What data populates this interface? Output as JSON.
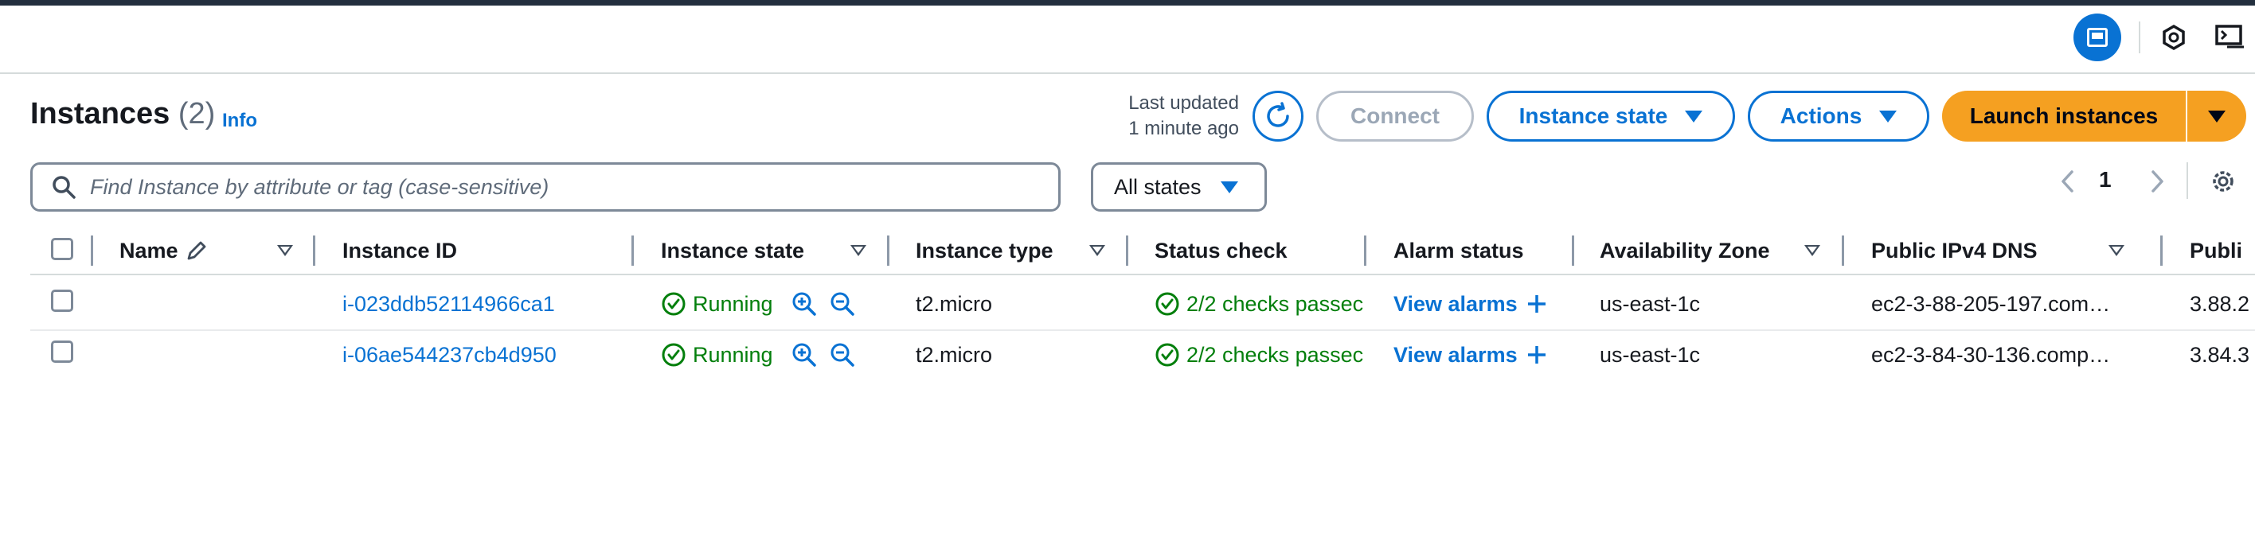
{
  "colors": {
    "accent": "#0972d3",
    "success": "#037f0c",
    "primary_button": "#f5a021",
    "border": "#7d8998"
  },
  "header": {
    "title": "Instances",
    "count": "(2)",
    "info_link": "Info",
    "last_updated_line1": "Last updated",
    "last_updated_line2": "1 minute ago",
    "connect_label": "Connect",
    "instance_state_label": "Instance state",
    "actions_label": "Actions",
    "launch_label": "Launch instances"
  },
  "search": {
    "placeholder": "Find Instance by attribute or tag (case-sensitive)"
  },
  "filter": {
    "states_label": "All states"
  },
  "pagination": {
    "current_page": "1"
  },
  "table": {
    "columns": [
      "Name",
      "Instance ID",
      "Instance state",
      "Instance type",
      "Status check",
      "Alarm status",
      "Availability Zone",
      "Public IPv4 DNS",
      "Publi"
    ],
    "rows": [
      {
        "name": "",
        "instance_id": "i-023ddb52114966ca1",
        "state": "Running",
        "type": "t2.micro",
        "status_check": "2/2 checks passec",
        "alarm": "View alarms",
        "az": "us-east-1c",
        "dns": "ec2-3-88-205-197.com…",
        "ip": "3.88.2"
      },
      {
        "name": "",
        "instance_id": "i-06ae544237cb4d950",
        "state": "Running",
        "type": "t2.micro",
        "status_check": "2/2 checks passec",
        "alarm": "View alarms",
        "az": "us-east-1c",
        "dns": "ec2-3-84-30-136.comp…",
        "ip": "3.84.3"
      }
    ]
  },
  "icons": [
    "panel-toggle-icon",
    "hexagon-settings-icon",
    "cloudshell-icon",
    "refresh-icon",
    "search-icon",
    "chevron-left-icon",
    "chevron-right-icon",
    "gear-icon",
    "pencil-icon",
    "zoom-in-icon",
    "zoom-out-icon",
    "check-circle-icon",
    "plus-icon"
  ]
}
